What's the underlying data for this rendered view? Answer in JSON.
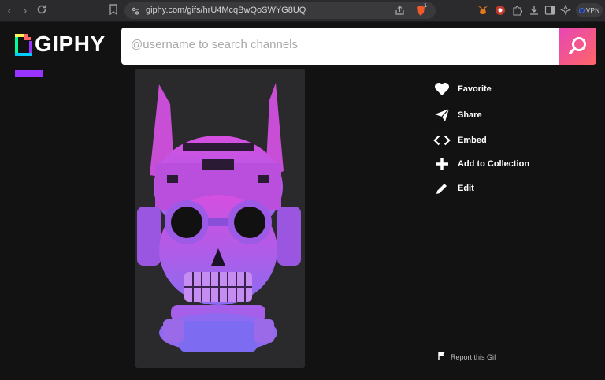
{
  "browser": {
    "url": "giphy.com/gifs/hrU4McqBwQoSWYG8UQ",
    "vpn_label": "VPN",
    "brave_badge": "1"
  },
  "header": {
    "logo_text": "GIPHY",
    "search_placeholder": "@username to search channels"
  },
  "actions": [
    {
      "label": "Favorite",
      "icon": "heart-icon"
    },
    {
      "label": "Share",
      "icon": "paper-plane-icon"
    },
    {
      "label": "Embed",
      "icon": "code-brackets-icon"
    },
    {
      "label": "Add to Collection",
      "icon": "plus-icon"
    },
    {
      "label": "Edit",
      "icon": "pencil-icon"
    }
  ],
  "report": {
    "label": "Report this Gif",
    "icon": "flag-icon"
  },
  "colors": {
    "background": "#121212",
    "accent_purple": "#9933ff",
    "search_gradient_start": "#e646b6",
    "search_gradient_end": "#ff6666"
  }
}
